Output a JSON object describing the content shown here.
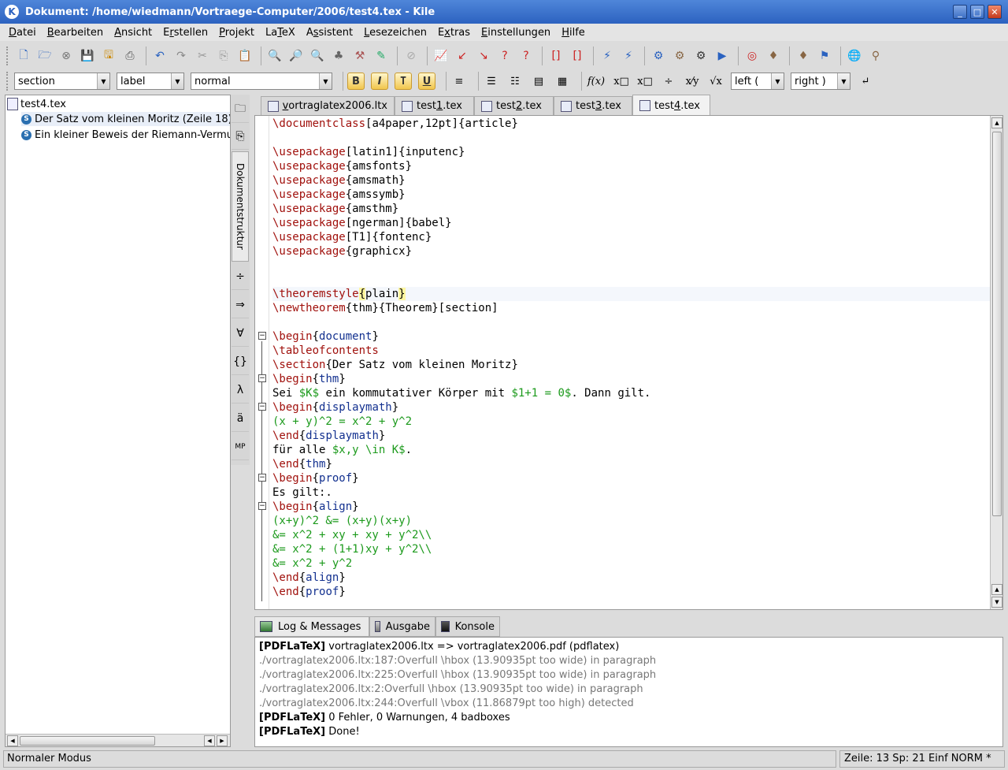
{
  "window": {
    "title": "Dokument: /home/wiedmann/Vortraege-Computer/2006/test4.tex - Kile",
    "app_icon": "K"
  },
  "menubar": [
    {
      "pre": "",
      "u": "D",
      "post": "atei"
    },
    {
      "pre": "",
      "u": "B",
      "post": "earbeiten"
    },
    {
      "pre": "",
      "u": "A",
      "post": "nsicht"
    },
    {
      "pre": "E",
      "u": "r",
      "post": "stellen"
    },
    {
      "pre": "",
      "u": "P",
      "post": "rojekt"
    },
    {
      "pre": "La",
      "u": "T",
      "post": "eX"
    },
    {
      "pre": "A",
      "u": "s",
      "post": "sistent"
    },
    {
      "pre": "",
      "u": "L",
      "post": "esezeichen"
    },
    {
      "pre": "E",
      "u": "x",
      "post": "tras"
    },
    {
      "pre": "",
      "u": "E",
      "post": "instellungen"
    },
    {
      "pre": "",
      "u": "H",
      "post": "ilfe"
    }
  ],
  "toolbar2": {
    "structure_combo": "section",
    "label_combo": "label",
    "size_combo": "normal",
    "bold": "B",
    "italic": "I",
    "typewriter": "T",
    "underline": "U",
    "fx": "f(x)",
    "sqrt": "√x",
    "left_combo": "left (",
    "right_combo": "right )"
  },
  "structure_tree": {
    "root": "test4.tex",
    "items": [
      "Der Satz vom kleinen Moritz (Zeile 18)",
      "Ein kleiner Beweis der Riemann-Vermutung"
    ]
  },
  "sidetab_label": "Dokumentstruktur",
  "editor_tabs": [
    {
      "pre": "",
      "u": "v",
      "post": "ortraglatex2006.ltx"
    },
    {
      "pre": "test",
      "u": "1",
      "post": ".tex"
    },
    {
      "pre": "test",
      "u": "2",
      "post": ".tex"
    },
    {
      "pre": "test",
      "u": "3",
      "post": ".tex"
    },
    {
      "pre": "test",
      "u": "4",
      "post": ".tex"
    }
  ],
  "code_lines": [
    [
      {
        "t": "\\documentclass",
        "c": "kw"
      },
      {
        "t": "[a4paper,12pt]{article}"
      }
    ],
    [],
    [
      {
        "t": "\\usepackage",
        "c": "kw"
      },
      {
        "t": "[latin1]{inputenc}"
      }
    ],
    [
      {
        "t": "\\usepackage",
        "c": "kw"
      },
      {
        "t": "{amsfonts}"
      }
    ],
    [
      {
        "t": "\\usepackage",
        "c": "kw"
      },
      {
        "t": "{amsmath}"
      }
    ],
    [
      {
        "t": "\\usepackage",
        "c": "kw"
      },
      {
        "t": "{amssymb}"
      }
    ],
    [
      {
        "t": "\\usepackage",
        "c": "kw"
      },
      {
        "t": "{amsthm}"
      }
    ],
    [
      {
        "t": "\\usepackage",
        "c": "kw"
      },
      {
        "t": "[ngerman]{babel}"
      }
    ],
    [
      {
        "t": "\\usepackage",
        "c": "kw"
      },
      {
        "t": "[T1]{fontenc}"
      }
    ],
    [
      {
        "t": "\\usepackage",
        "c": "kw"
      },
      {
        "t": "{graphicx}"
      }
    ],
    [],
    [],
    [
      {
        "t": "\\theoremstyle",
        "c": "kw"
      },
      {
        "t": "{",
        "c": "hl"
      },
      {
        "t": "plain"
      },
      {
        "t": "}",
        "c": "hl"
      }
    ],
    [
      {
        "t": "\\newtheorem",
        "c": "kw"
      },
      {
        "t": "{thm}{Theorem}[section]"
      }
    ],
    [],
    [
      {
        "t": "\\begin",
        "c": "kw"
      },
      {
        "t": "{"
      },
      {
        "t": "document",
        "c": "env"
      },
      {
        "t": "}"
      }
    ],
    [
      {
        "t": "\\tableofcontents",
        "c": "kw"
      }
    ],
    [
      {
        "t": "\\section",
        "c": "kw"
      },
      {
        "t": "{Der Satz vom kleinen Moritz}"
      }
    ],
    [
      {
        "t": "\\begin",
        "c": "kw"
      },
      {
        "t": "{"
      },
      {
        "t": "thm",
        "c": "env"
      },
      {
        "t": "}"
      }
    ],
    [
      {
        "t": "Sei "
      },
      {
        "t": "$K$",
        "c": "mth"
      },
      {
        "t": " ein kommutativer Körper mit "
      },
      {
        "t": "$1+1 = 0$",
        "c": "mth"
      },
      {
        "t": ". Dann gilt."
      }
    ],
    [
      {
        "t": "\\begin",
        "c": "kw"
      },
      {
        "t": "{"
      },
      {
        "t": "displaymath",
        "c": "env"
      },
      {
        "t": "}"
      }
    ],
    [
      {
        "t": "(x + y)^2 = x^2 + y^2",
        "c": "mth"
      }
    ],
    [
      {
        "t": "\\end",
        "c": "kw"
      },
      {
        "t": "{"
      },
      {
        "t": "displaymath",
        "c": "env"
      },
      {
        "t": "}"
      }
    ],
    [
      {
        "t": "für alle "
      },
      {
        "t": "$x,y \\in K$",
        "c": "mth"
      },
      {
        "t": "."
      }
    ],
    [
      {
        "t": "\\end",
        "c": "kw"
      },
      {
        "t": "{"
      },
      {
        "t": "thm",
        "c": "env"
      },
      {
        "t": "}"
      }
    ],
    [
      {
        "t": "\\begin",
        "c": "kw"
      },
      {
        "t": "{"
      },
      {
        "t": "proof",
        "c": "env"
      },
      {
        "t": "}"
      }
    ],
    [
      {
        "t": "Es gilt:."
      }
    ],
    [
      {
        "t": "\\begin",
        "c": "kw"
      },
      {
        "t": "{"
      },
      {
        "t": "align",
        "c": "env"
      },
      {
        "t": "}"
      }
    ],
    [
      {
        "t": "(x+y)^2 &= (x+y)(x+y)",
        "c": "mth"
      }
    ],
    [
      {
        "t": "&= x^2 + xy + xy + y^2\\\\",
        "c": "mth"
      }
    ],
    [
      {
        "t": "&= x^2 + (1+1)xy + y^2\\\\",
        "c": "mth"
      }
    ],
    [
      {
        "t": "&= x^2 + y^2",
        "c": "mth"
      }
    ],
    [
      {
        "t": "\\end",
        "c": "kw"
      },
      {
        "t": "{"
      },
      {
        "t": "align",
        "c": "env"
      },
      {
        "t": "}"
      }
    ],
    [
      {
        "t": "\\end",
        "c": "kw"
      },
      {
        "t": "{"
      },
      {
        "t": "proof",
        "c": "env"
      },
      {
        "t": "}"
      }
    ]
  ],
  "log_tabs": [
    "Log & Messages",
    "Ausgabe",
    "Konsole"
  ],
  "log_lines": [
    {
      "tag": "[PDFLaTeX]",
      "text": " vortraglatex2006.ltx => vortraglatex2006.pdf (pdflatex)",
      "warn": false
    },
    {
      "tag": "",
      "text": "./vortraglatex2006.ltx:187:Overfull \\hbox (13.90935pt too wide) in paragraph",
      "warn": true
    },
    {
      "tag": "",
      "text": "./vortraglatex2006.ltx:225:Overfull \\hbox (13.90935pt too wide) in paragraph",
      "warn": true
    },
    {
      "tag": "",
      "text": "./vortraglatex2006.ltx:2:Overfull \\hbox (13.90935pt too wide) in paragraph",
      "warn": true
    },
    {
      "tag": "",
      "text": "./vortraglatex2006.ltx:244:Overfull \\vbox (11.86879pt too high) detected",
      "warn": true
    },
    {
      "tag": "[PDFLaTeX]",
      "text": " 0 Fehler, 0 Warnungen, 4 badboxes",
      "warn": false
    },
    {
      "tag": "[PDFLaTeX]",
      "text": " Done!",
      "warn": false
    }
  ],
  "status": {
    "mode": "Normaler Modus",
    "position": "Zeile: 13 Sp: 21  Einf  NORM  *"
  },
  "icons": {
    "toolbar1": [
      "new-file-icon",
      "open-file-icon",
      "close-file-icon",
      "save-icon",
      "save-all-icon",
      "print-icon",
      "undo-icon",
      "redo-icon",
      "cut-icon",
      "copy-icon",
      "paste-icon",
      "find-icon",
      "zoom-icon",
      "find-next-icon",
      "tree-icon",
      "tools-icon",
      "spell-icon",
      "stop-icon",
      "statistics-icon",
      "jump-prev-icon",
      "jump-next-icon",
      "help-icon",
      "help2-icon",
      "bracket-icon",
      "bracket2-icon",
      "quick-build-icon",
      "latex-icon",
      "compile-icon",
      "build-icon",
      "view-icon",
      "run-icon",
      "pdf-icon",
      "dvi-to-ps-icon",
      "ps-to-pdf-icon",
      "view-pdf-icon",
      "web-icon",
      "symbols-icon"
    ]
  }
}
